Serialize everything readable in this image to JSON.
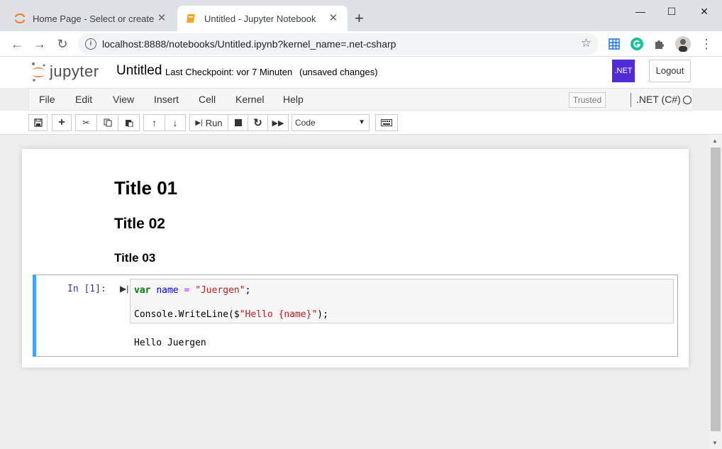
{
  "browser": {
    "tabs": [
      {
        "title": "Home Page - Select or create a n",
        "active": false
      },
      {
        "title": "Untitled - Jupyter Notebook",
        "active": true
      }
    ],
    "new_tab": "+",
    "window": {
      "minimize": "—",
      "maximize": "☐",
      "close": "✕"
    },
    "url": "localhost:8888/notebooks/Untitled.ipynb?kernel_name=.net-csharp"
  },
  "header": {
    "logo_text": "jupyter",
    "notebook_name": "Untitled",
    "checkpoint": "Last Checkpoint: vor 7 Minuten",
    "autosave": "(unsaved changes)",
    "badge": ".NET",
    "logout": "Logout"
  },
  "menubar": {
    "items": [
      "File",
      "Edit",
      "View",
      "Insert",
      "Cell",
      "Kernel",
      "Help"
    ],
    "trusted": "Trusted",
    "kernel": ".NET (C#)"
  },
  "toolbar": {
    "run_label": "Run",
    "cell_type": "Code"
  },
  "notebook": {
    "headings": [
      "Title 01",
      "Title 02",
      "Title 03"
    ],
    "cell": {
      "prompt": "In [1]:",
      "line1": {
        "kw": "var",
        "name": "name",
        "op": "=",
        "str": "\"Juergen\"",
        "end": ";"
      },
      "line2": {
        "pre": "Console.WriteLine($",
        "str": "\"Hello {name}\"",
        "end": ");"
      },
      "output": "Hello Juergen"
    }
  }
}
